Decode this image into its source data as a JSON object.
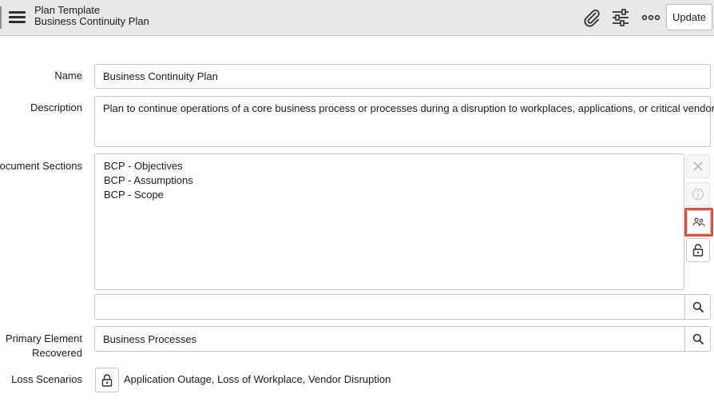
{
  "header": {
    "title_line1": "Plan Template",
    "title_line2": "Business Continuity Plan",
    "update_label": "Update",
    "icons": [
      "menu-icon",
      "paperclip-icon",
      "sliders-icon",
      "more-icon"
    ]
  },
  "form": {
    "name": {
      "label": "Name",
      "value": "Business Continuity Plan"
    },
    "description": {
      "label": "Description",
      "value": "Plan to continue operations of a core business process or processes during a disruption to workplaces, applications, or critical vendors."
    },
    "document_sections": {
      "label": "Document Sections",
      "items": [
        "BCP - Objectives",
        "BCP - Assumptions",
        "BCP - Scope"
      ],
      "search_value": "",
      "side_icons": [
        "close-icon",
        "info-icon",
        "users-icon",
        "unlock-icon"
      ]
    },
    "primary_element": {
      "label_line1": "Primary Element",
      "label_line2": "Recovered",
      "value": "Business Processes"
    },
    "loss_scenarios": {
      "label": "Loss Scenarios",
      "value": "Application Outage, Loss of Workplace, Vendor Disruption"
    }
  },
  "colors": {
    "header_bg": "#e6e8ea",
    "highlight": "#e0503b",
    "border": "#c2c6ca"
  }
}
